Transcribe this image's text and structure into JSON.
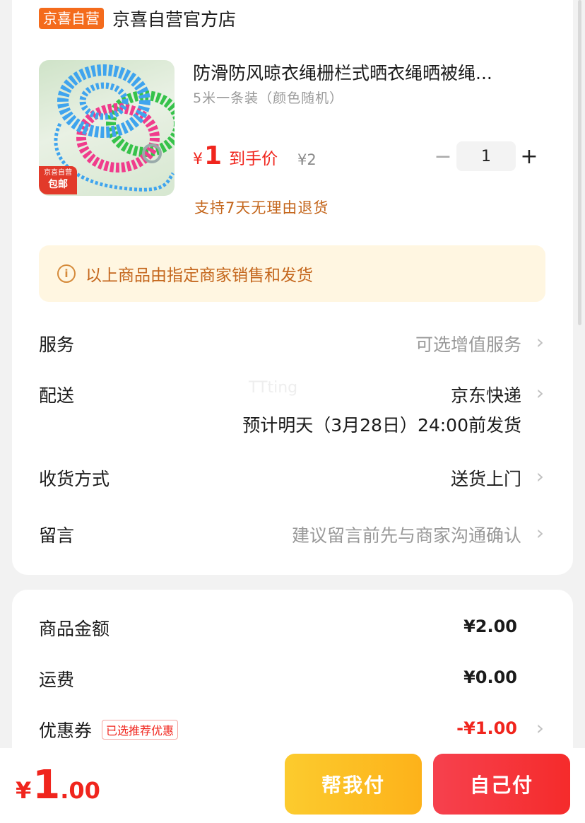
{
  "shop": {
    "badge": "京喜自营",
    "name": "京喜自营官方店"
  },
  "product": {
    "title": "防滑防风晾衣绳栅栏式晒衣绳晒被绳...",
    "spec": "5米一条装（颜色随机）",
    "price_symbol": "¥",
    "price": "1",
    "price_label": "到手价",
    "original_price": "¥2",
    "quantity": "1",
    "image_badge_line1": "京喜自营",
    "image_badge_line2": "包邮",
    "return_policy": "支持7天无理由退货"
  },
  "notice": {
    "text": "以上商品由指定商家销售和发货"
  },
  "rows": {
    "service": {
      "label": "服务",
      "value": "可选增值服务"
    },
    "delivery": {
      "label": "配送",
      "value": "京东快递",
      "sub": "预计明天（3月28日）24:00前发货"
    },
    "receive": {
      "label": "收货方式",
      "value": "送货上门"
    },
    "message": {
      "label": "留言",
      "value": "建议留言前先与商家沟通确认"
    }
  },
  "watermark": "TTting",
  "summary": {
    "goods": {
      "label": "商品金额",
      "value": "¥2.00"
    },
    "shipping": {
      "label": "运费",
      "value": "¥0.00"
    },
    "coupon": {
      "label": "优惠券",
      "tag": "已选推荐优惠",
      "value": "-¥1.00"
    }
  },
  "bottom": {
    "total_symbol": "¥",
    "total_int": "1",
    "total_dec": ".00",
    "help_pay": "帮我付",
    "self_pay": "自己付"
  },
  "colors": {
    "accent_red": "#f0251d",
    "shop_badge": "#f46b1c",
    "help_btn": "#fdb21a",
    "self_btn": "#f52b2b"
  },
  "icons": {
    "minus": "minus-icon",
    "plus": "plus-icon",
    "info": "info-icon",
    "chevron": "chevron-right-icon"
  }
}
